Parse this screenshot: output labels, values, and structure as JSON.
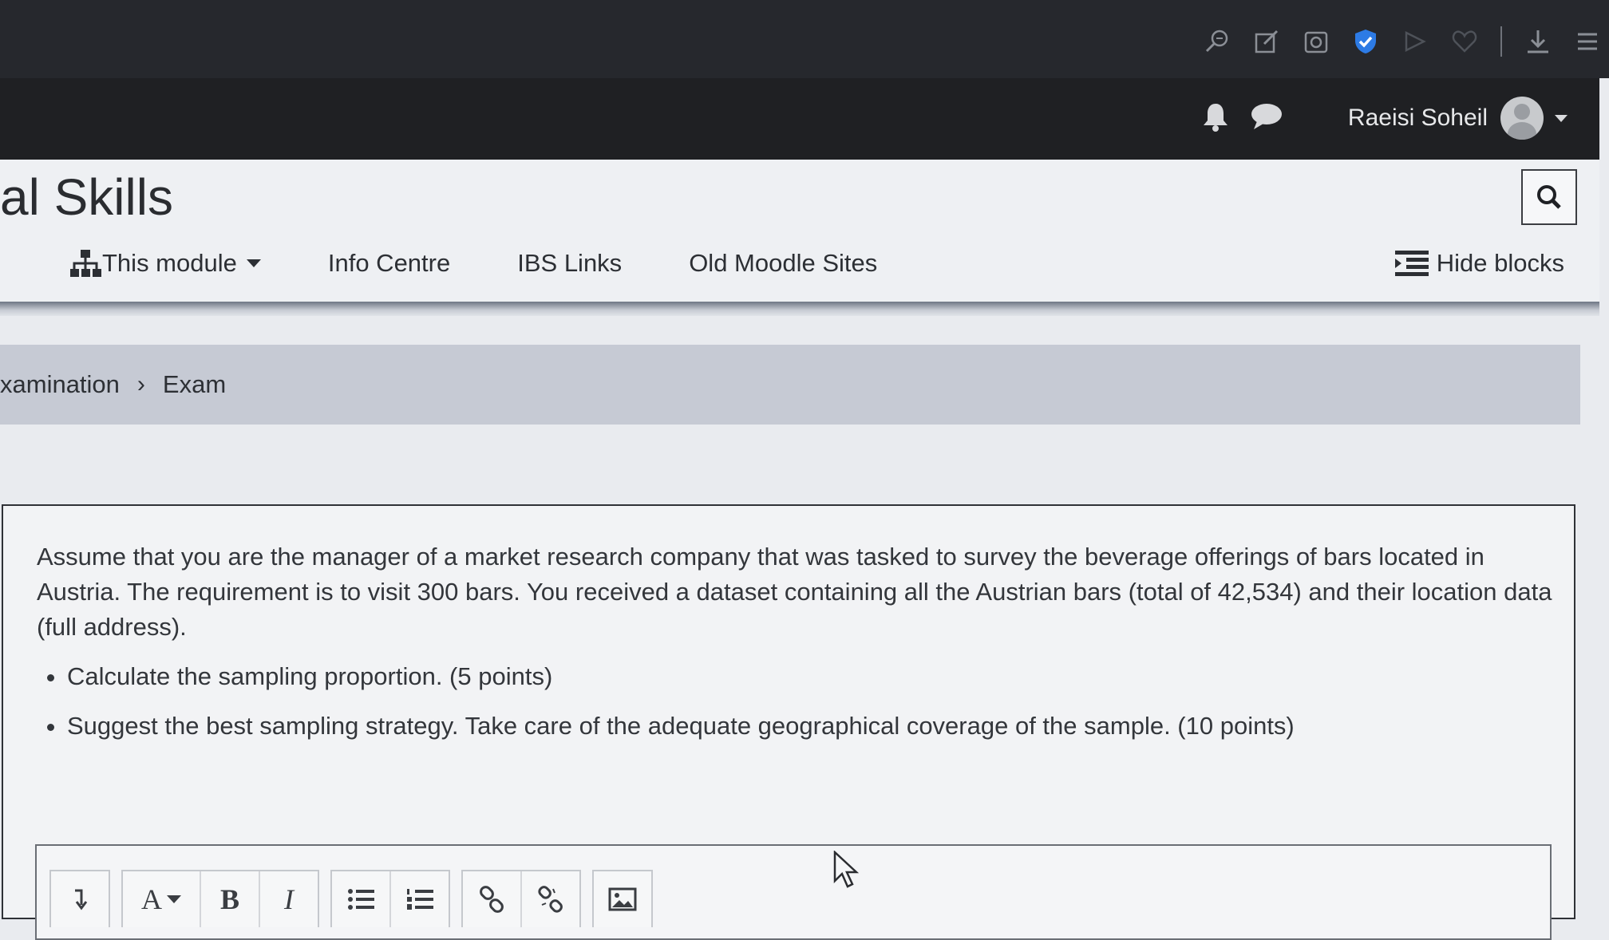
{
  "browser_toolbar": {
    "icons": [
      "zoom-icon",
      "edit-icon",
      "screenshot-icon",
      "shield-check-icon",
      "play-icon",
      "heart-icon",
      "download-icon",
      "menu-icon"
    ]
  },
  "site_bar": {
    "user_name": "Raeisi Soheil"
  },
  "header": {
    "title": "al Skills",
    "nav": [
      {
        "label": "This module"
      },
      {
        "label": "Info Centre"
      },
      {
        "label": "IBS Links"
      },
      {
        "label": "Old Moodle Sites"
      }
    ],
    "hide_blocks_label": "Hide blocks"
  },
  "breadcrumb": {
    "items": [
      "xamination",
      "Exam"
    ],
    "separator": "›"
  },
  "question": {
    "text": "Assume that you are the manager of a market research company that was tasked to survey the beverage offerings of bars located in Austria. The requirement is to visit 300 bars. You received a dataset containing all the Austrian bars (total of 42,534) and their location data (full address).",
    "bullets": [
      "Calculate the sampling proportion. (5 points)",
      "Suggest the best sampling strategy. Take care of the adequate geographical coverage of the sample. (10 points)"
    ]
  },
  "editor_toolbar": {
    "buttons": [
      "collapse-icon",
      "font-color-icon",
      "bold-icon",
      "italic-icon",
      "unordered-list-icon",
      "ordered-list-icon",
      "link-icon",
      "unlink-icon",
      "image-icon"
    ],
    "font_label": "A",
    "bold_label": "B",
    "italic_label": "I"
  },
  "colors": {
    "browser_bar": "#26282d",
    "site_bar": "#1f2023",
    "header_bg": "#eef0f3",
    "breadcrumb_bg": "#c6cad4",
    "accent_blue": "#2d7be5"
  }
}
